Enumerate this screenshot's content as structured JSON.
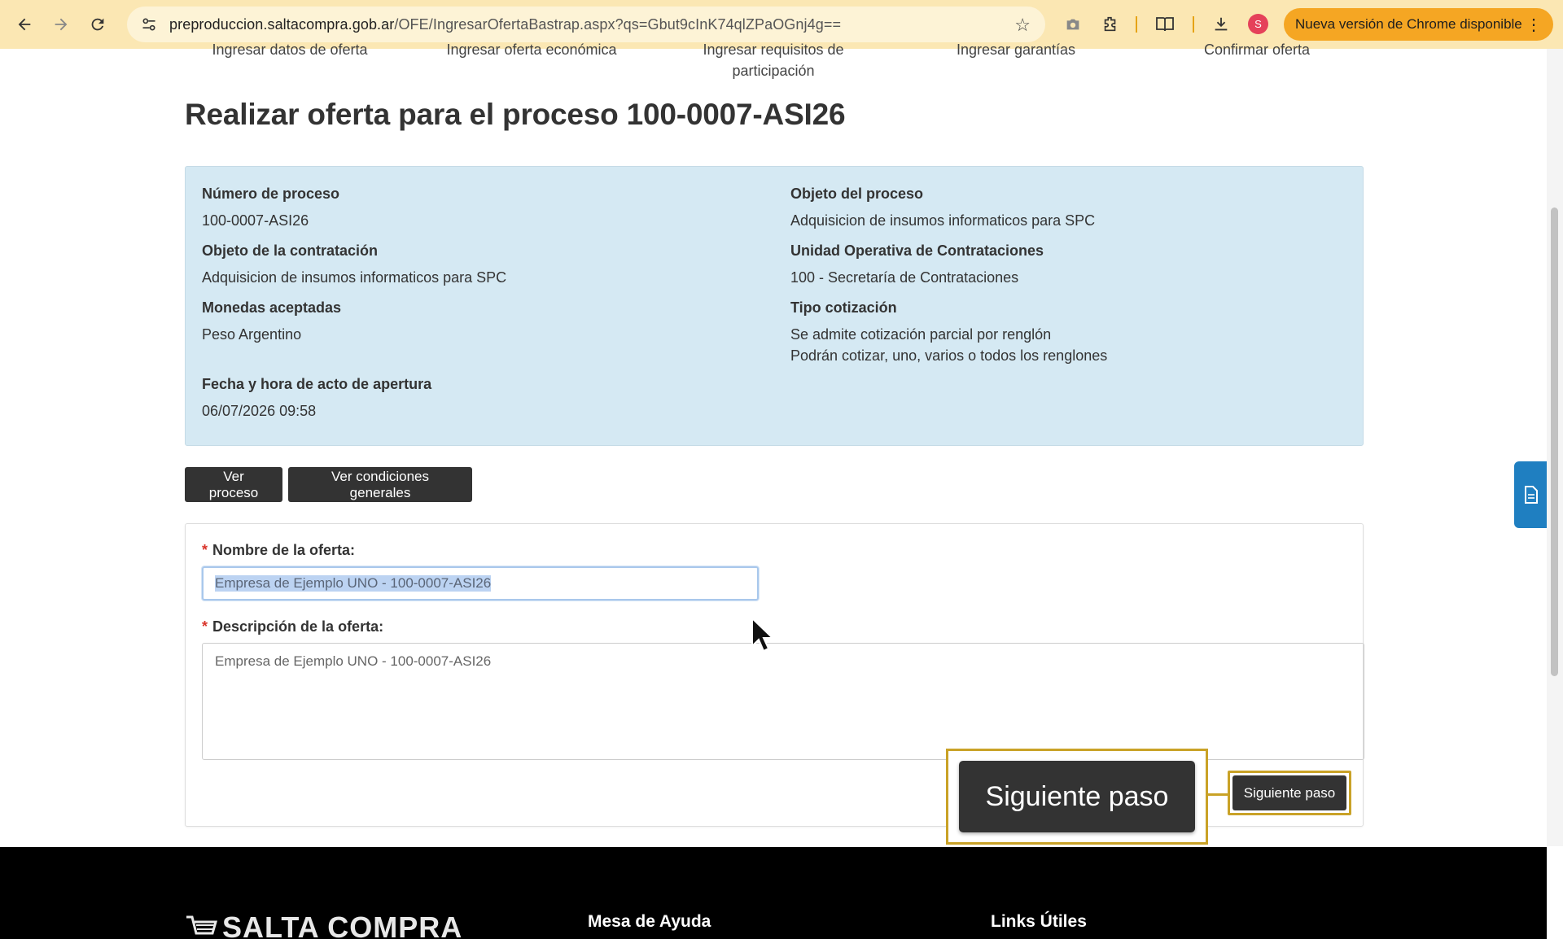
{
  "browser": {
    "url_host": "preproduccion.saltacompra.gob.ar",
    "url_path": "/OFE/IngresarOfertaBastrap.aspx?qs=Gbut9cInK74qlZPaOGnj4g==",
    "profile_initial": "S",
    "update_label": "Nueva versión de Chrome disponible"
  },
  "steps": [
    "Ingresar datos de oferta",
    "Ingresar oferta económica",
    "Ingresar requisitos de",
    "participación",
    "Ingresar garantías",
    "Confirmar oferta"
  ],
  "page": {
    "title": "Realizar oferta para el proceso 100-0007-ASI26"
  },
  "info": {
    "numero_label": "Número de proceso",
    "numero_value": "100-0007-ASI26",
    "objeto_proceso_label": "Objeto del proceso",
    "objeto_proceso_value": "Adquisicion de insumos informaticos para SPC",
    "objeto_contratacion_label": "Objeto de la contratación",
    "objeto_contratacion_value": "Adquisicion de insumos informaticos para SPC",
    "unidad_label": "Unidad Operativa de Contrataciones",
    "unidad_value": "100 - Secretaría de Contrataciones",
    "monedas_label": "Monedas aceptadas",
    "monedas_value": "Peso Argentino",
    "tipo_label": "Tipo cotización",
    "tipo_value_1": "Se admite cotización parcial por renglón",
    "tipo_value_2": "Podrán cotizar, uno, varios o todos los renglones",
    "fecha_label": "Fecha y hora de acto de apertura",
    "fecha_value": "06/07/2026 09:58"
  },
  "actions": {
    "ver_proceso": "Ver proceso",
    "ver_condiciones": "Ver condiciones generales"
  },
  "form": {
    "required_mark": "*",
    "nombre_label": "Nombre de la oferta:",
    "nombre_value": "Empresa de Ejemplo UNO - 100-0007-ASI26",
    "descripcion_label": "Descripción de la oferta:",
    "descripcion_value": "Empresa de Ejemplo UNO - 100-0007-ASI26",
    "next_label": "Siguiente paso",
    "next_zoom_label": "Siguiente paso"
  },
  "footer": {
    "logo_text": "SALTA COMPRA",
    "mesa_ayuda": "Mesa de Ayuda",
    "links_utiles": "Links Útiles"
  }
}
